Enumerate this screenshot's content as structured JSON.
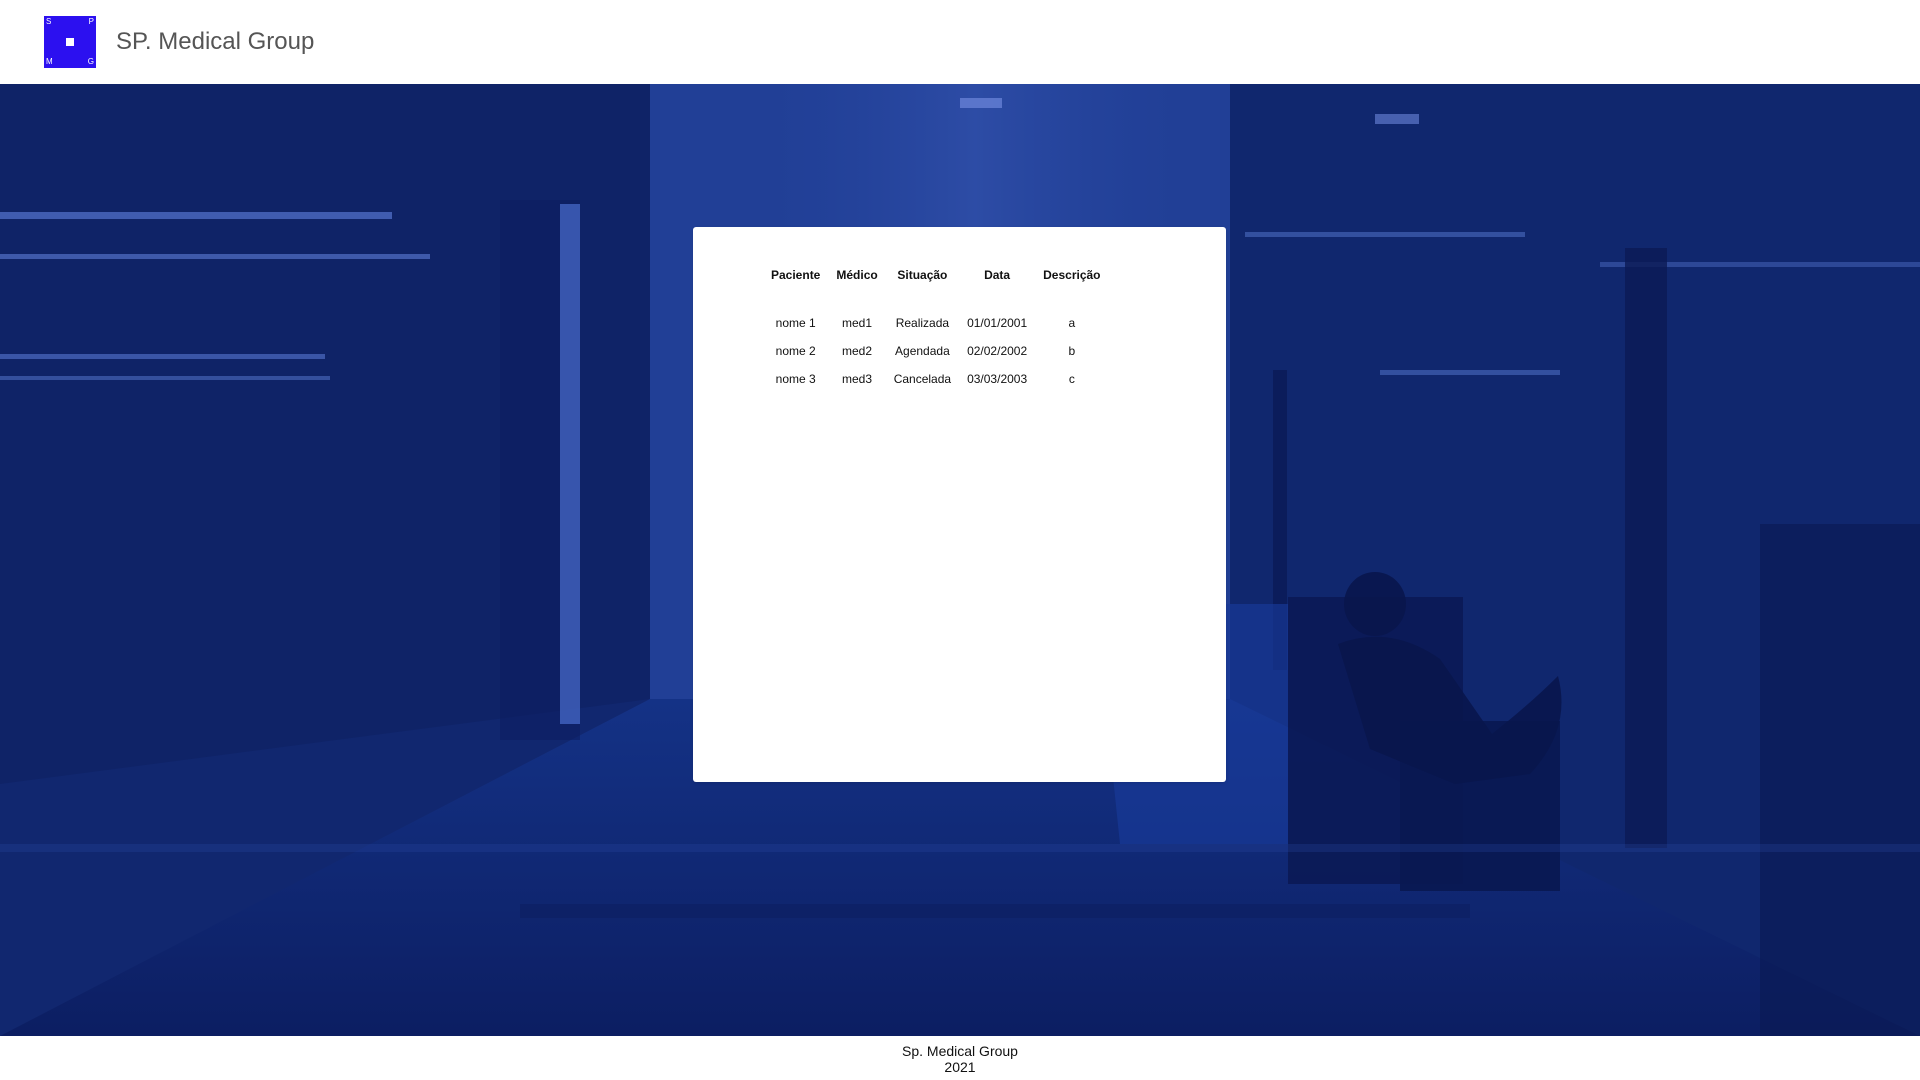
{
  "header": {
    "logo": {
      "letters": [
        "S",
        "P",
        "M",
        "G"
      ],
      "color": "#2c10f0"
    },
    "title": "SP. Medical Group"
  },
  "appointments": {
    "columns": [
      "Paciente",
      "Médico",
      "Situação",
      "Data",
      "Descrição"
    ],
    "rows": [
      {
        "paciente": "nome 1",
        "medico": "med1",
        "situacao": "Realizada",
        "data": "01/01/2001",
        "descricao": "a"
      },
      {
        "paciente": "nome 2",
        "medico": "med2",
        "situacao": "Agendada",
        "data": "02/02/2002",
        "descricao": "b"
      },
      {
        "paciente": "nome 3",
        "medico": "med3",
        "situacao": "Cancelada",
        "data": "03/03/2003",
        "descricao": "c"
      }
    ]
  },
  "footer": {
    "company": "Sp. Medical Group",
    "year": "2021"
  },
  "colors": {
    "brand": "#2c10f0",
    "hero_overlay": "#102976",
    "panel_background": "#ffffff"
  }
}
